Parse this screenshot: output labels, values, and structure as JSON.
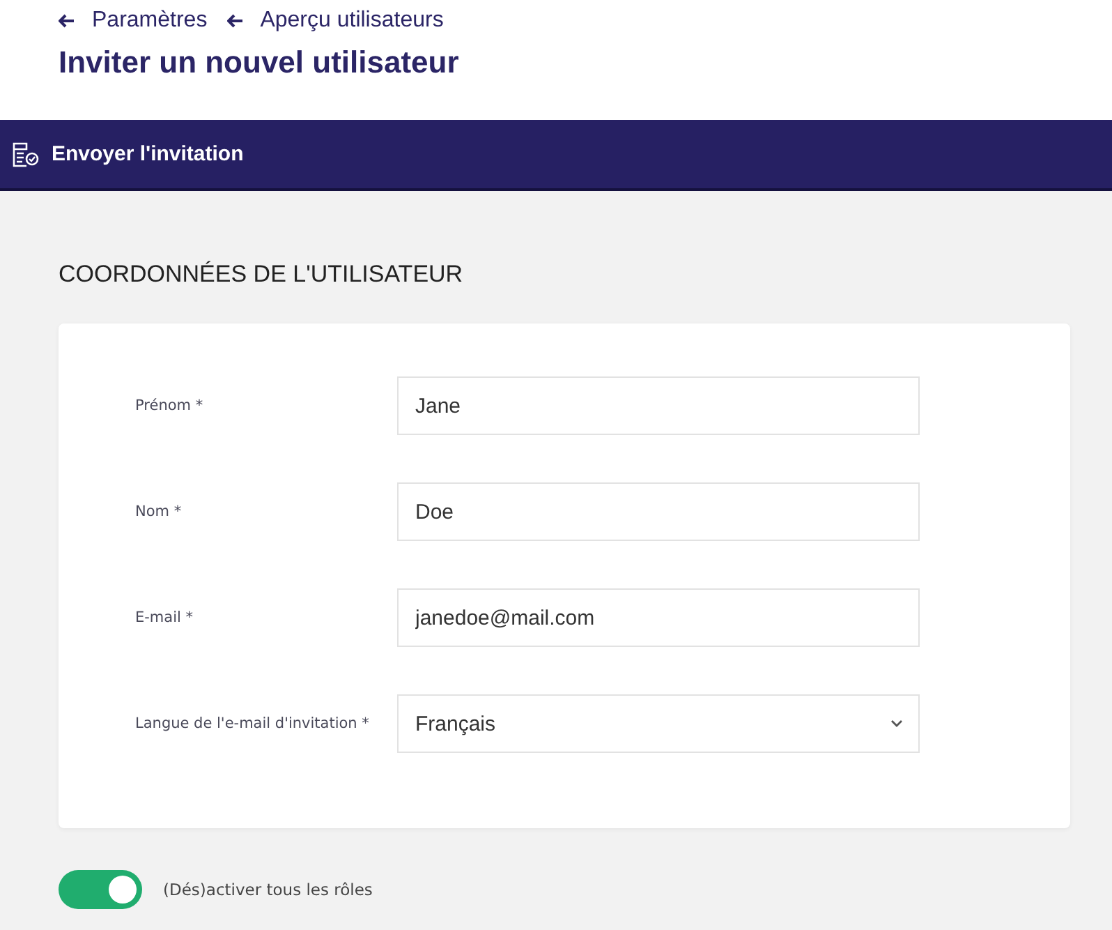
{
  "breadcrumbs": [
    {
      "label": "Paramètres"
    },
    {
      "label": "Aperçu utilisateurs"
    }
  ],
  "title": "Inviter un nouvel utilisateur",
  "action_bar": {
    "button": "Envoyer l'invitation"
  },
  "section_title": "COORDONNÉES DE L'UTILISATEUR",
  "fields": [
    {
      "kind": "text",
      "label": "Prénom *",
      "value": "Jane"
    },
    {
      "kind": "text",
      "label": "Nom *",
      "value": "Doe"
    },
    {
      "kind": "text",
      "label": "E-mail *",
      "value": "janedoe@mail.com"
    },
    {
      "kind": "select",
      "label": "Langue de l'e-mail d'invitation *",
      "value": "Français"
    }
  ],
  "toggle": {
    "label": "(Dés)activer tous les rôles",
    "on": true
  }
}
